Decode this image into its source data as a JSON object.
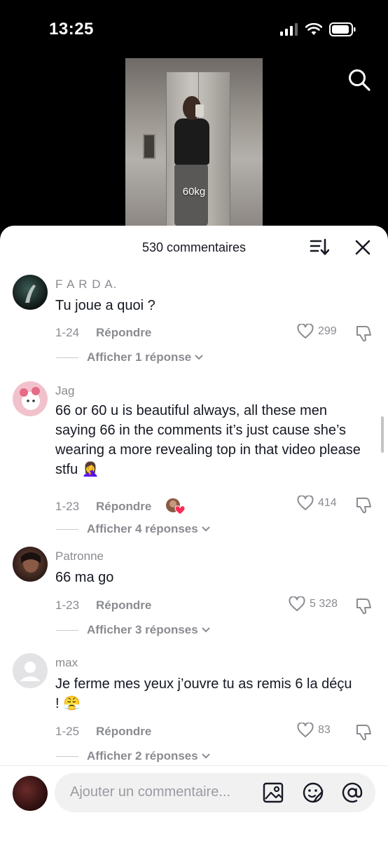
{
  "status_bar": {
    "time": "13:25",
    "icons": [
      "cellular-signal-icon",
      "wifi-icon",
      "battery-icon"
    ]
  },
  "video": {
    "overlay_text": "60kg",
    "search_icon": "search-icon"
  },
  "comments_sheet": {
    "title": "530 commentaires",
    "sort_icon": "sort-icon",
    "close_icon": "close-icon",
    "comments": [
      {
        "username": "F A R D A.",
        "text": "Tu joue a quoi ?",
        "date": "1-24",
        "reply_label": "Répondre",
        "likes": "299",
        "replies_label": "Afficher 1 réponse"
      },
      {
        "username": "Jag",
        "text": "66 or 60 u is beautiful always, all these men saying 66 in the comments it’s just cause she’s wearing a more revealing top in that video please stfu 🤦‍♀️",
        "date": "1-23",
        "reply_label": "Répondre",
        "creator_liked": true,
        "likes": "414",
        "replies_label": "Afficher 4 réponses"
      },
      {
        "username": "Patronne",
        "text": "66 ma go",
        "date": "1-23",
        "reply_label": "Répondre",
        "likes": "5 328",
        "replies_label": "Afficher 3 réponses"
      },
      {
        "username": "max",
        "text": "Je ferme mes yeux j’ouvre tu as remis 6 la déçu ! 😤",
        "date": "1-25",
        "reply_label": "Répondre",
        "likes": "83",
        "replies_label": "Afficher 2 réponses"
      }
    ]
  },
  "composer": {
    "placeholder": "Ajouter un commentaire...",
    "icons": [
      "image-icon",
      "emoji-icon",
      "mention-icon"
    ]
  },
  "colors": {
    "text_primary": "#161823",
    "text_secondary": "#8a8b91",
    "like_heart": "#fe2c55"
  }
}
